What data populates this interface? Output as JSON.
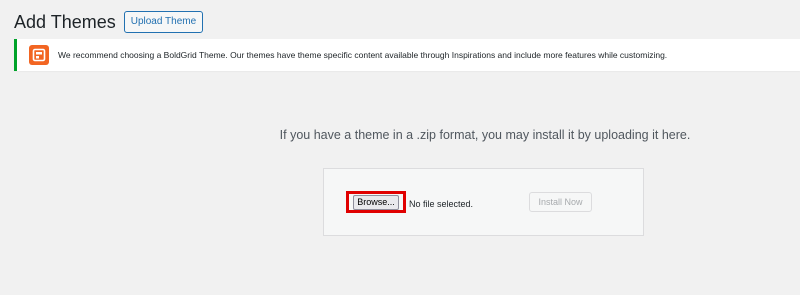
{
  "header": {
    "title": "Add Themes",
    "upload_button_label": "Upload Theme"
  },
  "notice": {
    "text": "We recommend choosing a BoldGrid Theme. Our themes have theme specific content available through Inspirations and include more features while customizing.",
    "border_color": "#00a32a",
    "logo_color": "#f26522",
    "logo_icon": "boldgrid-logo-icon"
  },
  "upload": {
    "instruction": "If you have a theme in a .zip format, you may install it by uploading it here.",
    "browse_label": "Browse...",
    "file_status": "No file selected.",
    "install_label": "Install Now"
  },
  "colors": {
    "background": "#f1f1f1",
    "accent": "#2271b1",
    "highlight": "#e00000"
  }
}
